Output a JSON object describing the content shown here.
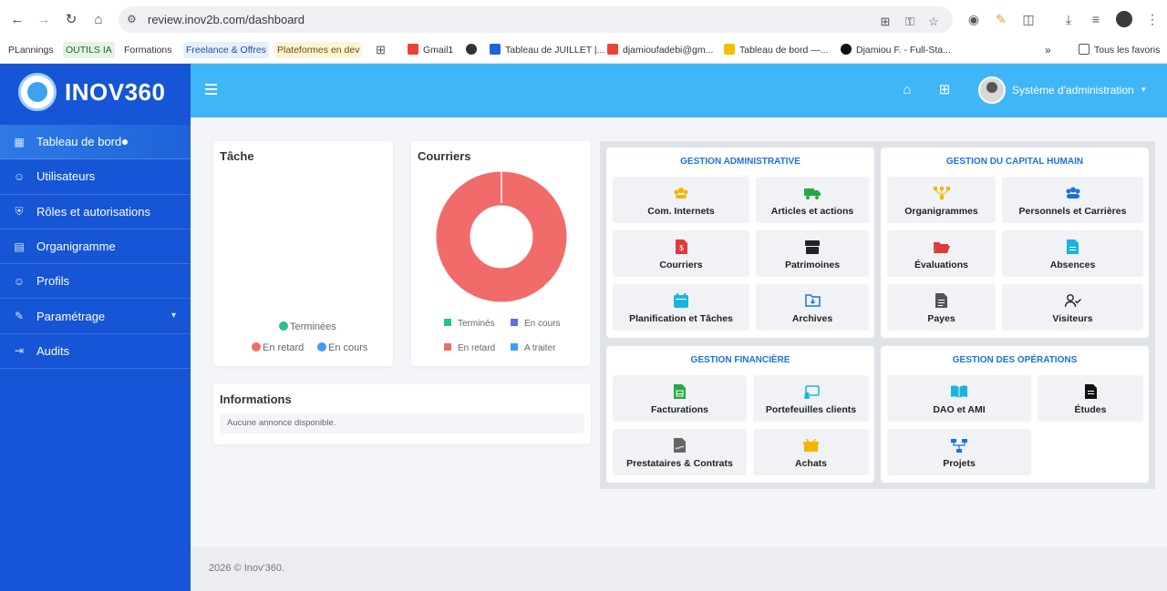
{
  "browser": {
    "url": "review.inov2b.com/dashboard",
    "bookmarks": [
      {
        "label": "PLannings"
      },
      {
        "label": "OUTILS IA"
      },
      {
        "label": "Formations"
      },
      {
        "label": "Freelance & Offres"
      },
      {
        "label": "Plateformes en dev"
      },
      {
        "label": "Gmail1"
      },
      {
        "label": "Tableau de JUILLET |..."
      },
      {
        "label": "djamioufadebi@gm..."
      },
      {
        "label": "Tableau de bord —..."
      },
      {
        "label": "Djamiou F. - Full-Sta..."
      },
      {
        "label": "Tous les favoris"
      }
    ],
    "more_label": "»"
  },
  "sidebar": {
    "logo_text": "INOV360",
    "items": [
      {
        "label": "Tableau de bord",
        "icon": "dashboard-icon"
      },
      {
        "label": "Utilisateurs",
        "icon": "user-icon"
      },
      {
        "label": "Rôles et autorisations",
        "icon": "shield-icon"
      },
      {
        "label": "Organigramme",
        "icon": "building-icon"
      },
      {
        "label": "Profils",
        "icon": "user-icon"
      },
      {
        "label": "Paramétrage",
        "icon": "wrench-icon"
      },
      {
        "label": "Audits",
        "icon": "sign-in-icon"
      }
    ]
  },
  "header": {
    "user_name": "Système d'administration"
  },
  "tache": {
    "title": "Tâche",
    "legend": [
      "Terminées",
      "En retard",
      "En cours"
    ]
  },
  "courriers": {
    "title": "Courriers",
    "legend": [
      "Terminés",
      "En cours",
      "En retard",
      "A traiter"
    ]
  },
  "informations": {
    "title": "Informations",
    "empty": "Aucune annonce disponible."
  },
  "modules": {
    "admin": {
      "title": "GESTION ADMINISTRATIVE",
      "tiles": [
        "Com. Internets",
        "Articles et actions",
        "Courriers",
        "Patrimoines",
        "Planification et Tâches",
        "Archives"
      ]
    },
    "capital": {
      "title": "GESTION DU CAPITAL HUMAIN",
      "tiles": [
        "Organigrammes",
        "Personnels et Carrières",
        "Évaluations",
        "Absences",
        "Payes",
        "Visiteurs"
      ]
    },
    "finance": {
      "title": "GESTION FINANCIÈRE",
      "tiles": [
        "Facturations",
        "Portefeuilles clients",
        "Prestataires & Contrats",
        "Achats"
      ]
    },
    "operations": {
      "title": "GESTION DES OPÉRATIONS",
      "tiles": [
        "DAO et AMI",
        "Études",
        "Projets"
      ]
    }
  },
  "footer": {
    "text": "2026 © Inov'360."
  },
  "colors": {
    "sidebar": "#1555d6",
    "header": "#3fb6f7",
    "donut": "#f26b6b",
    "module_title": "#1a73d9"
  }
}
